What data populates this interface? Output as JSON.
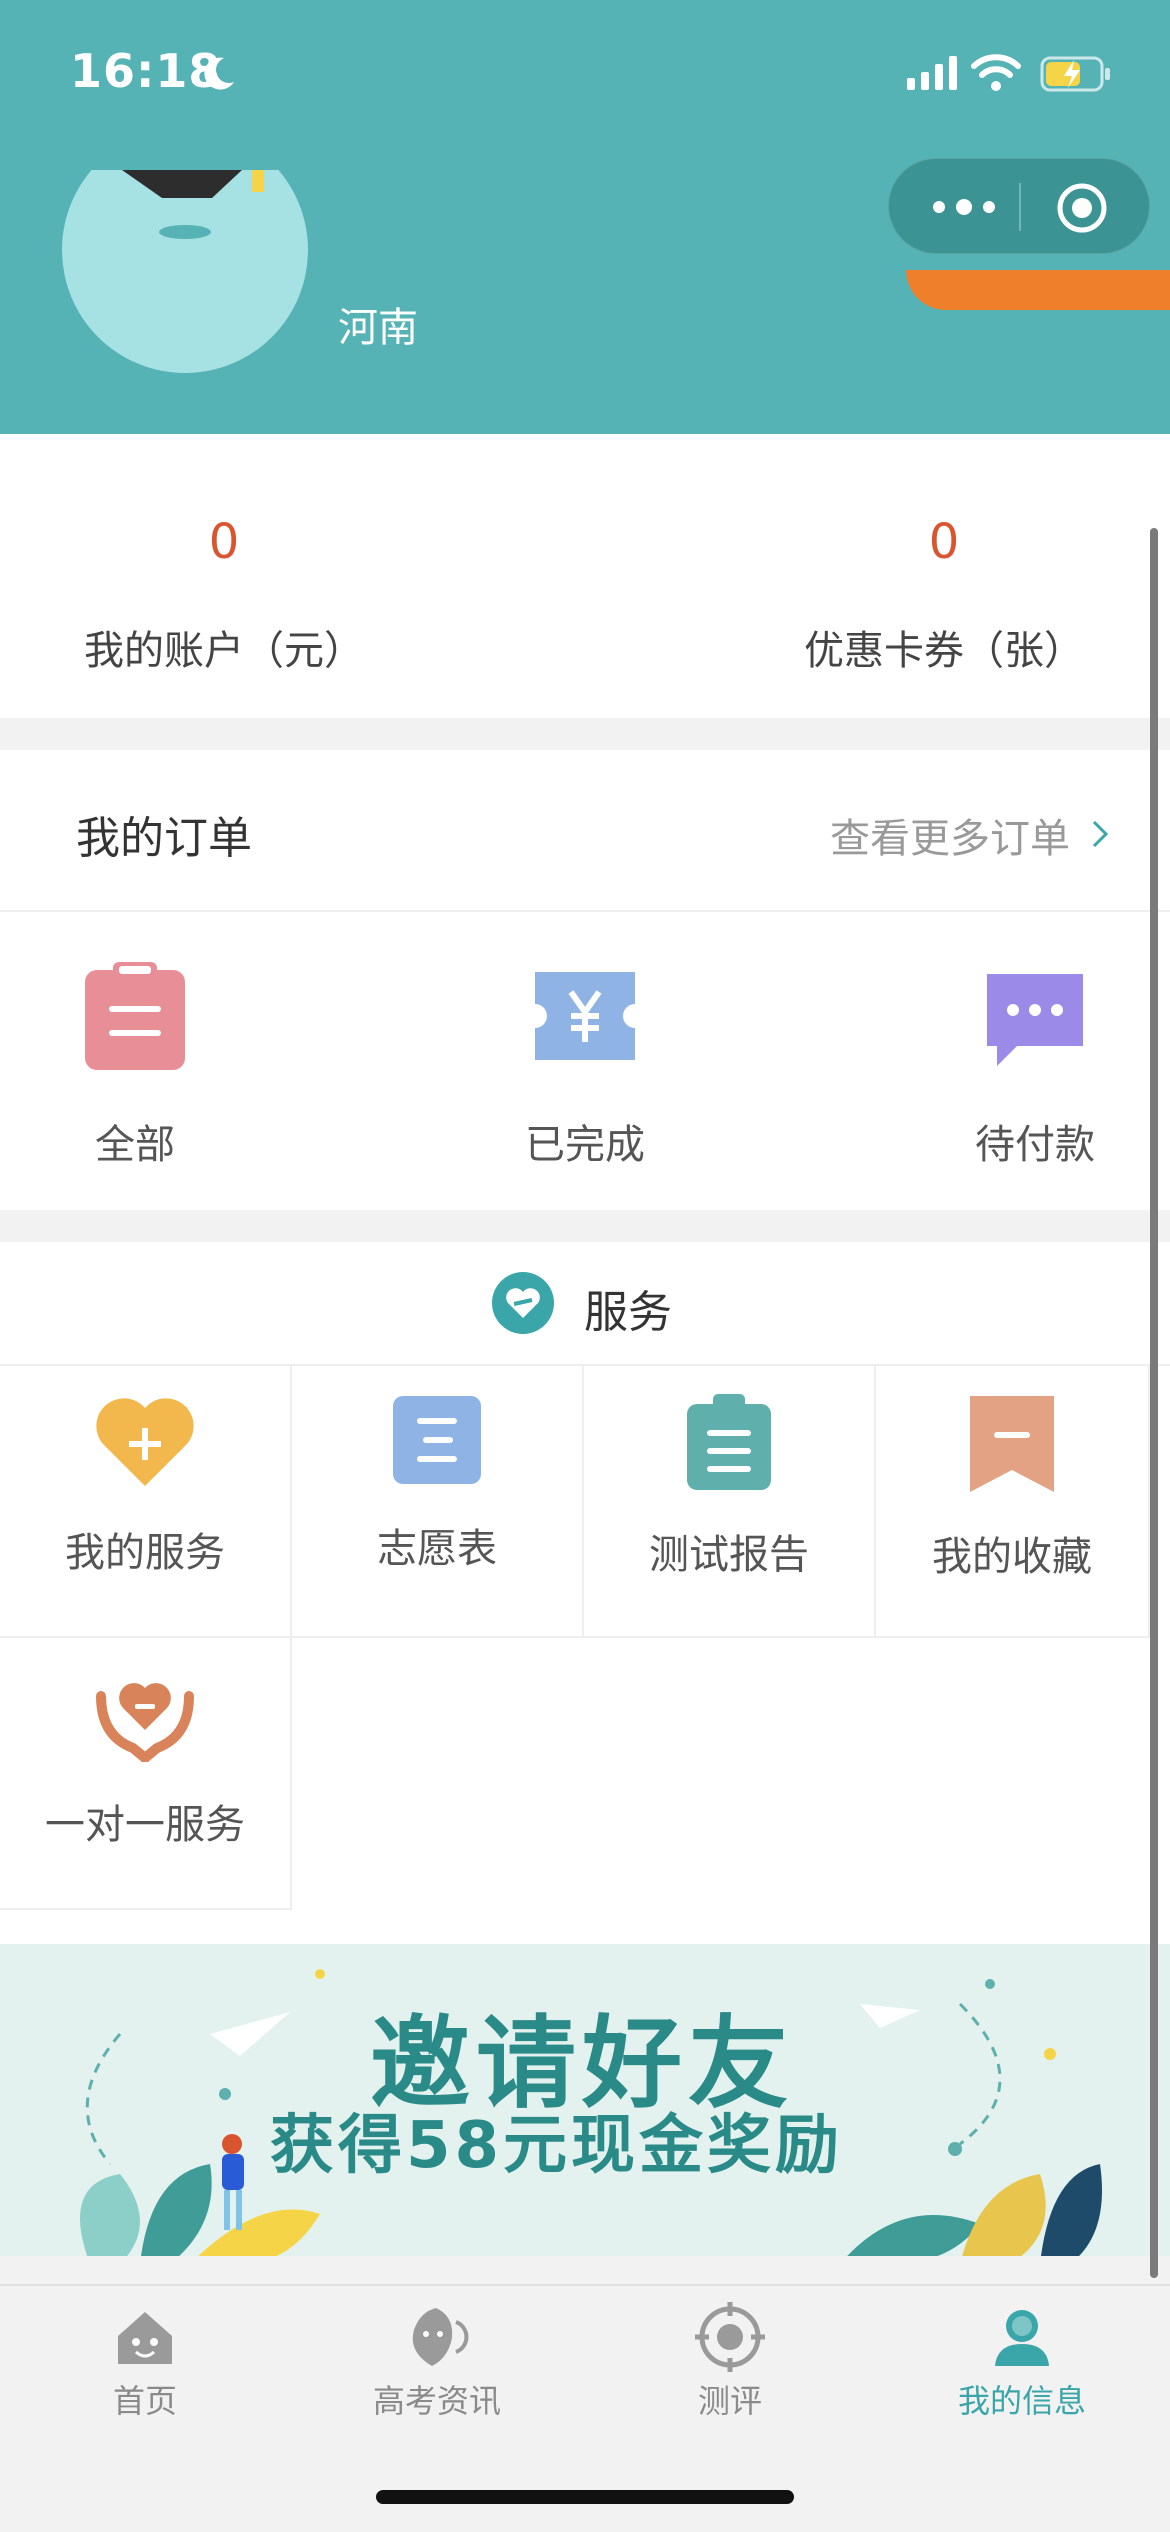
{
  "status_bar": {
    "time": "16:18"
  },
  "profile": {
    "region": "河南"
  },
  "account": [
    {
      "value": "0",
      "label": "我的账户（元）"
    },
    {
      "value": "0",
      "label": "优惠卡券（张）"
    }
  ],
  "orders": {
    "title": "我的订单",
    "more": "查看更多订单",
    "items": [
      {
        "label": "全部",
        "icon": "clipboard-icon"
      },
      {
        "label": "已完成",
        "icon": "ticket-yuan-icon"
      },
      {
        "label": "待付款",
        "icon": "chat-bubble-icon"
      }
    ]
  },
  "services": {
    "title": "服务",
    "items": [
      {
        "label": "我的服务",
        "icon": "heart-plus-icon"
      },
      {
        "label": "志愿表",
        "icon": "list-icon"
      },
      {
        "label": "测试报告",
        "icon": "report-icon"
      },
      {
        "label": "我的收藏",
        "icon": "bookmark-icon"
      },
      {
        "label": "一对一服务",
        "icon": "hands-heart-icon"
      }
    ]
  },
  "banner": {
    "line1": "邀请好友",
    "line2": "获得58元现金奖励"
  },
  "tabbar": [
    {
      "label": "首页",
      "active": false
    },
    {
      "label": "高考资讯",
      "active": false
    },
    {
      "label": "测评",
      "active": false
    },
    {
      "label": "我的信息",
      "active": true
    }
  ],
  "colors": {
    "header": "#56b3b5",
    "accent": "#3aa6a9",
    "value_red": "#d9552f"
  }
}
